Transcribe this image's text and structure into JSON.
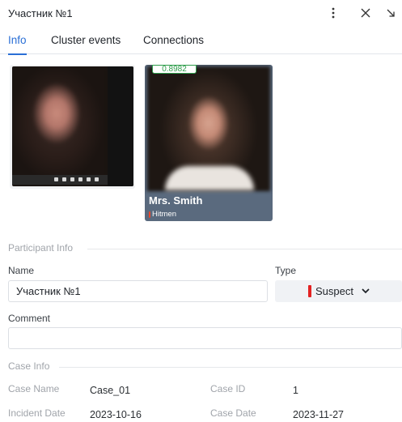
{
  "header": {
    "title": "Участник №1",
    "icons": [
      "more-vertical-icon",
      "close-icon",
      "minimize-arrow-icon"
    ]
  },
  "tabs": [
    {
      "label": "Info",
      "active": true
    },
    {
      "label": "Cluster events",
      "active": false
    },
    {
      "label": "Connections",
      "active": false
    }
  ],
  "cards": {
    "match": {
      "score": "0.8982",
      "name": "Mrs. Smith",
      "group": "Hitmen"
    }
  },
  "participant_info": {
    "section_title": "Participant Info",
    "name_label": "Name",
    "name_value": "Участник №1",
    "type_label": "Type",
    "type_value": "Suspect",
    "type_color": "#e32222",
    "comment_label": "Comment",
    "comment_value": ""
  },
  "case_info": {
    "section_title": "Case Info",
    "case_name_label": "Case Name",
    "case_name_value": "Case_01",
    "case_id_label": "Case ID",
    "case_id_value": "1",
    "incident_date_label": "Incident Date",
    "incident_date_value": "2023-10-16",
    "case_date_label": "Case Date",
    "case_date_value": "2023-11-27"
  },
  "colors": {
    "accent": "#2a6fd6",
    "score_badge": "#2e9d4b",
    "card_bg": "#5a6a7e"
  }
}
